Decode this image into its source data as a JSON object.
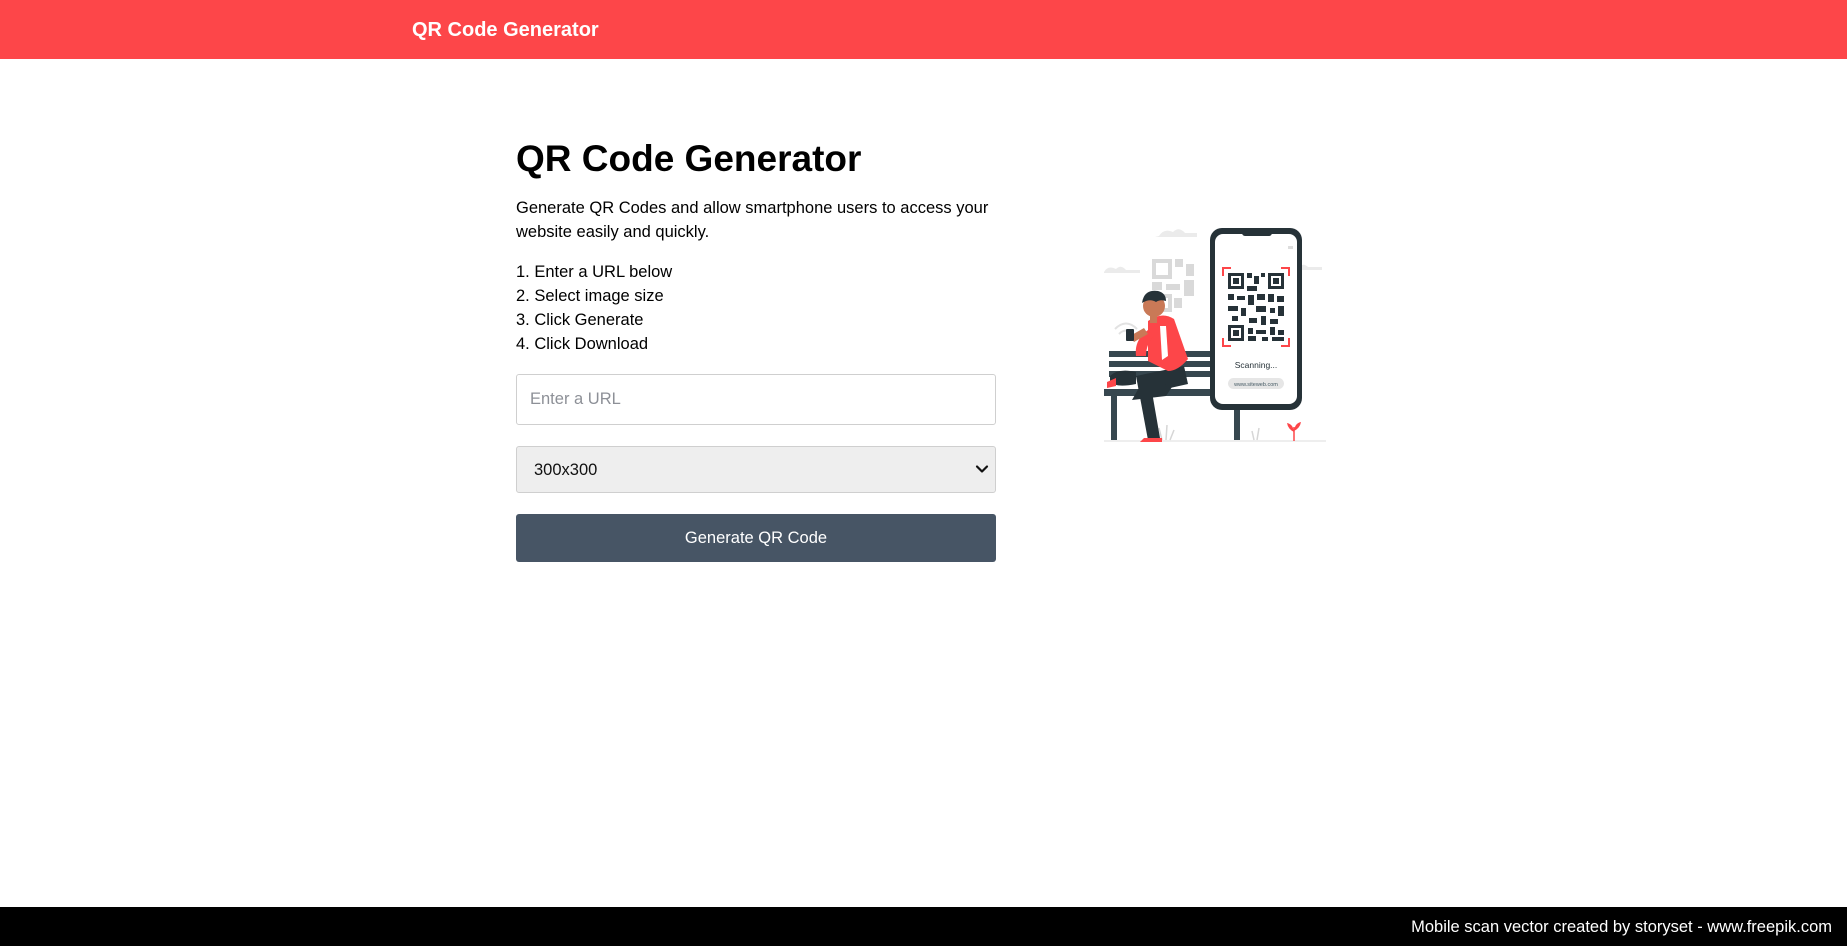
{
  "header": {
    "brand": "QR Code Generator",
    "accent_color": "#fd4649"
  },
  "main": {
    "title": "QR Code Generator",
    "intro": "Generate QR Codes and allow smartphone users to access your website easily and quickly.",
    "steps": [
      "1. Enter a URL below",
      "2. Select image size",
      "3. Click Generate",
      "4. Click Download"
    ],
    "url_input": {
      "placeholder": "Enter a URL",
      "value": ""
    },
    "size_select": {
      "selected": "300x300"
    },
    "generate_button": {
      "label": "Generate QR Code",
      "color": "#475565"
    }
  },
  "illustration": {
    "icon": "mobile-scan-illustration",
    "scanning_text": "Scanning...",
    "url_chip_text": "www.siteweb.com"
  },
  "footer": {
    "credit": "Mobile scan vector created by storyset - www.freepik.com"
  }
}
